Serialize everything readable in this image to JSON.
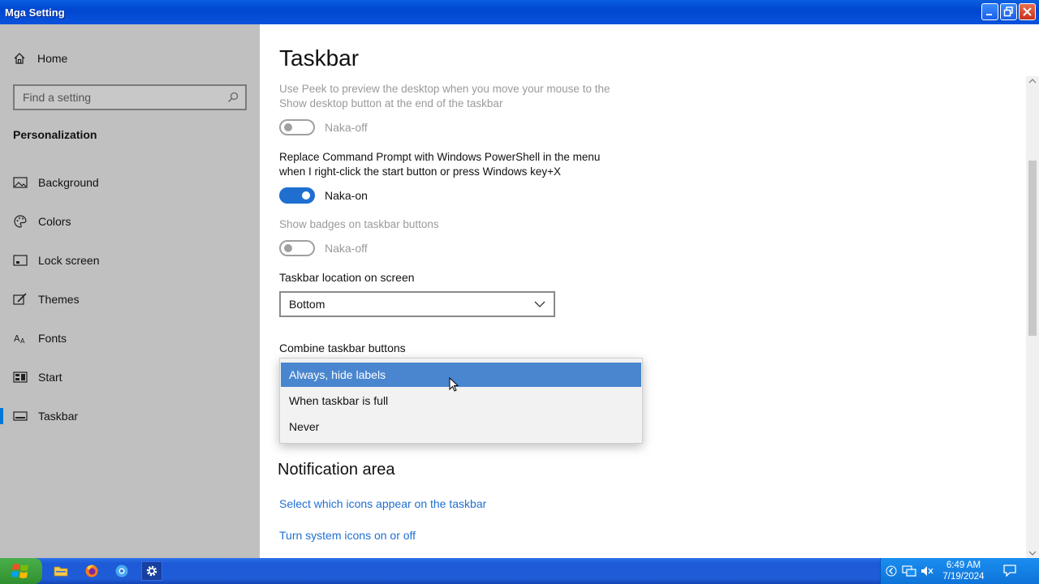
{
  "window": {
    "title": "Mga Setting"
  },
  "sidebar": {
    "home_label": "Home",
    "search_placeholder": "Find a setting",
    "section_title": "Personalization",
    "items": [
      {
        "label": "Background",
        "icon": "picture-icon"
      },
      {
        "label": "Colors",
        "icon": "palette-icon"
      },
      {
        "label": "Lock screen",
        "icon": "lock-screen-icon"
      },
      {
        "label": "Themes",
        "icon": "brush-icon"
      },
      {
        "label": "Fonts",
        "icon": "font-icon"
      },
      {
        "label": "Start",
        "icon": "start-icon"
      },
      {
        "label": "Taskbar",
        "icon": "taskbar-icon",
        "active": true
      }
    ]
  },
  "main": {
    "title": "Taskbar",
    "peek": {
      "line1": "Use Peek to preview the desktop when you move your mouse to the",
      "line2": "Show desktop button at the end of the taskbar",
      "state_label": "Naka-off",
      "on": false
    },
    "powershell": {
      "line1": "Replace Command Prompt with Windows PowerShell in the menu",
      "line2": "when I right-click the start button or press Windows key+X",
      "state_label": "Naka-on",
      "on": true
    },
    "badges": {
      "label": "Show badges on taskbar buttons",
      "state_label": "Naka-off",
      "on": false
    },
    "location": {
      "label": "Taskbar location on screen",
      "value": "Bottom"
    },
    "combine": {
      "label": "Combine taskbar buttons",
      "options": [
        "Always, hide labels",
        "When taskbar is full",
        "Never"
      ],
      "highlighted": "Always, hide labels"
    },
    "notification": {
      "heading": "Notification area",
      "link1": "Select which icons appear on the taskbar",
      "link2": "Turn system icons on or off"
    }
  },
  "taskbar": {
    "time": "6:49 AM",
    "date": "7/19/2024"
  }
}
